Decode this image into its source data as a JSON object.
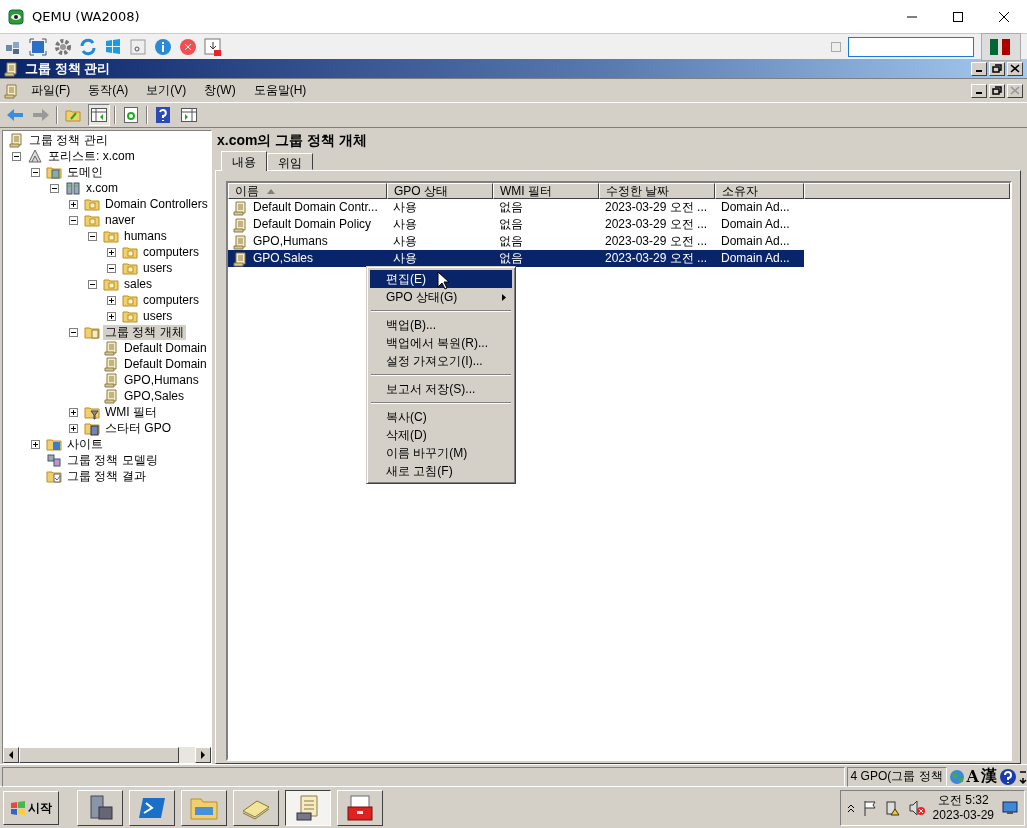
{
  "window": {
    "title": "QEMU (WA2008)"
  },
  "console": {
    "title": "그룹 정책 관리"
  },
  "menu": [
    "파일(F)",
    "동작(A)",
    "보기(V)",
    "창(W)",
    "도움말(H)"
  ],
  "tree": [
    {
      "label": "그룹 정책 관리",
      "kind": "console",
      "selected": false,
      "children": [
        {
          "label": "포리스트: x.com",
          "kind": "forest",
          "expanded": true,
          "selected": false,
          "children": [
            {
              "label": "도메인",
              "kind": "domains",
              "expanded": true,
              "selected": false,
              "children": [
                {
                  "label": "x.com",
                  "kind": "domain",
                  "expanded": true,
                  "selected": false,
                  "children": [
                    {
                      "label": "Domain Controllers",
                      "kind": "ou",
                      "expanded": false,
                      "selected": false
                    },
                    {
                      "label": "naver",
                      "kind": "ou",
                      "expanded": true,
                      "selected": false,
                      "children": [
                        {
                          "label": "humans",
                          "kind": "ou",
                          "expanded": true,
                          "selected": false,
                          "children": [
                            {
                              "label": "computers",
                              "kind": "ou",
                              "expanded": false,
                              "selected": false
                            },
                            {
                              "label": "users",
                              "kind": "ou",
                              "expanded": true,
                              "selected": false
                            }
                          ]
                        },
                        {
                          "label": "sales",
                          "kind": "ou",
                          "expanded": true,
                          "selected": false,
                          "children": [
                            {
                              "label": "computers",
                              "kind": "ou",
                              "expanded": false,
                              "selected": false
                            },
                            {
                              "label": "users",
                              "kind": "ou",
                              "expanded": false,
                              "selected": false
                            }
                          ]
                        }
                      ]
                    },
                    {
                      "label": "그룹 정책 개체",
                      "kind": "gpo-folder",
                      "expanded": true,
                      "selected": true,
                      "children": [
                        {
                          "label": "Default Domain",
                          "kind": "gpo",
                          "selected": false
                        },
                        {
                          "label": "Default Domain",
                          "kind": "gpo",
                          "selected": false
                        },
                        {
                          "label": "GPO,Humans",
                          "kind": "gpo",
                          "selected": false
                        },
                        {
                          "label": "GPO,Sales",
                          "kind": "gpo",
                          "selected": false
                        }
                      ]
                    },
                    {
                      "label": "WMI 필터",
                      "kind": "wmi",
                      "expanded": false,
                      "selected": false
                    },
                    {
                      "label": "스타터 GPO",
                      "kind": "starter",
                      "expanded": false,
                      "selected": false
                    }
                  ]
                }
              ]
            },
            {
              "label": "사이트",
              "kind": "sites",
              "expanded": false,
              "selected": false
            },
            {
              "label": "그룹 정책 모델링",
              "kind": "modeling",
              "selected": false
            },
            {
              "label": "그룹 정책 결과",
              "kind": "results",
              "selected": false
            }
          ]
        }
      ]
    }
  ],
  "panel": {
    "heading": "x.com의 그룹 정책 개체",
    "tabs": [
      {
        "label": "내용",
        "selected": true
      },
      {
        "label": "위임",
        "selected": false
      }
    ],
    "columns": [
      {
        "label": "이름",
        "sorted": true
      },
      {
        "label": "GPO 상태",
        "sorted": false
      },
      {
        "label": "WMI 필터",
        "sorted": false
      },
      {
        "label": "수정한 날짜",
        "sorted": false
      },
      {
        "label": "소유자",
        "sorted": false
      }
    ],
    "rows": [
      {
        "cells": [
          "Default Domain Contr...",
          "사용",
          "없음",
          "2023-03-29 오전 ...",
          "Domain Ad..."
        ],
        "selected": false
      },
      {
        "cells": [
          "Default Domain Policy",
          "사용",
          "없음",
          "2023-03-29 오전 ...",
          "Domain Ad..."
        ],
        "selected": false
      },
      {
        "cells": [
          "GPO,Humans",
          "사용",
          "없음",
          "2023-03-29 오전 ...",
          "Domain Ad..."
        ],
        "selected": false
      },
      {
        "cells": [
          "GPO,Sales",
          "사용",
          "없음",
          "2023-03-29 오전 ...",
          "Domain Ad..."
        ],
        "selected": true
      }
    ]
  },
  "context_menu": [
    {
      "kind": "item",
      "label": "편집(E)",
      "selected": true,
      "submenu": false
    },
    {
      "kind": "item",
      "label": "GPO 상태(G)",
      "selected": false,
      "submenu": true
    },
    {
      "kind": "separator"
    },
    {
      "kind": "item",
      "label": "백업(B)...",
      "selected": false,
      "submenu": false
    },
    {
      "kind": "item",
      "label": "백업에서 복원(R)...",
      "selected": false,
      "submenu": false
    },
    {
      "kind": "item",
      "label": "설정 가져오기(I)...",
      "selected": false,
      "submenu": false
    },
    {
      "kind": "separator"
    },
    {
      "kind": "item",
      "label": "보고서 저장(S)...",
      "selected": false,
      "submenu": false
    },
    {
      "kind": "separator"
    },
    {
      "kind": "item",
      "label": "복사(C)",
      "selected": false,
      "submenu": false
    },
    {
      "kind": "item",
      "label": "삭제(D)",
      "selected": false,
      "submenu": false
    },
    {
      "kind": "item",
      "label": "이름 바꾸기(M)",
      "selected": false,
      "submenu": false
    },
    {
      "kind": "item",
      "label": "새로 고침(F)",
      "selected": false,
      "submenu": false
    }
  ],
  "status_bar": {
    "text": "4 GPO(그룹 정책",
    "ime_mode": "A",
    "ime_hanja": "漢"
  },
  "taskbar": {
    "start": "시작",
    "apps": [
      {
        "kind": "server",
        "selected": false
      },
      {
        "kind": "shell",
        "selected": false
      },
      {
        "kind": "explorer",
        "selected": false
      },
      {
        "kind": "book",
        "selected": false
      },
      {
        "kind": "gpo",
        "selected": true
      },
      {
        "kind": "toolbox",
        "selected": false
      }
    ],
    "time": "오전 5:32",
    "date": "2023-03-29"
  }
}
